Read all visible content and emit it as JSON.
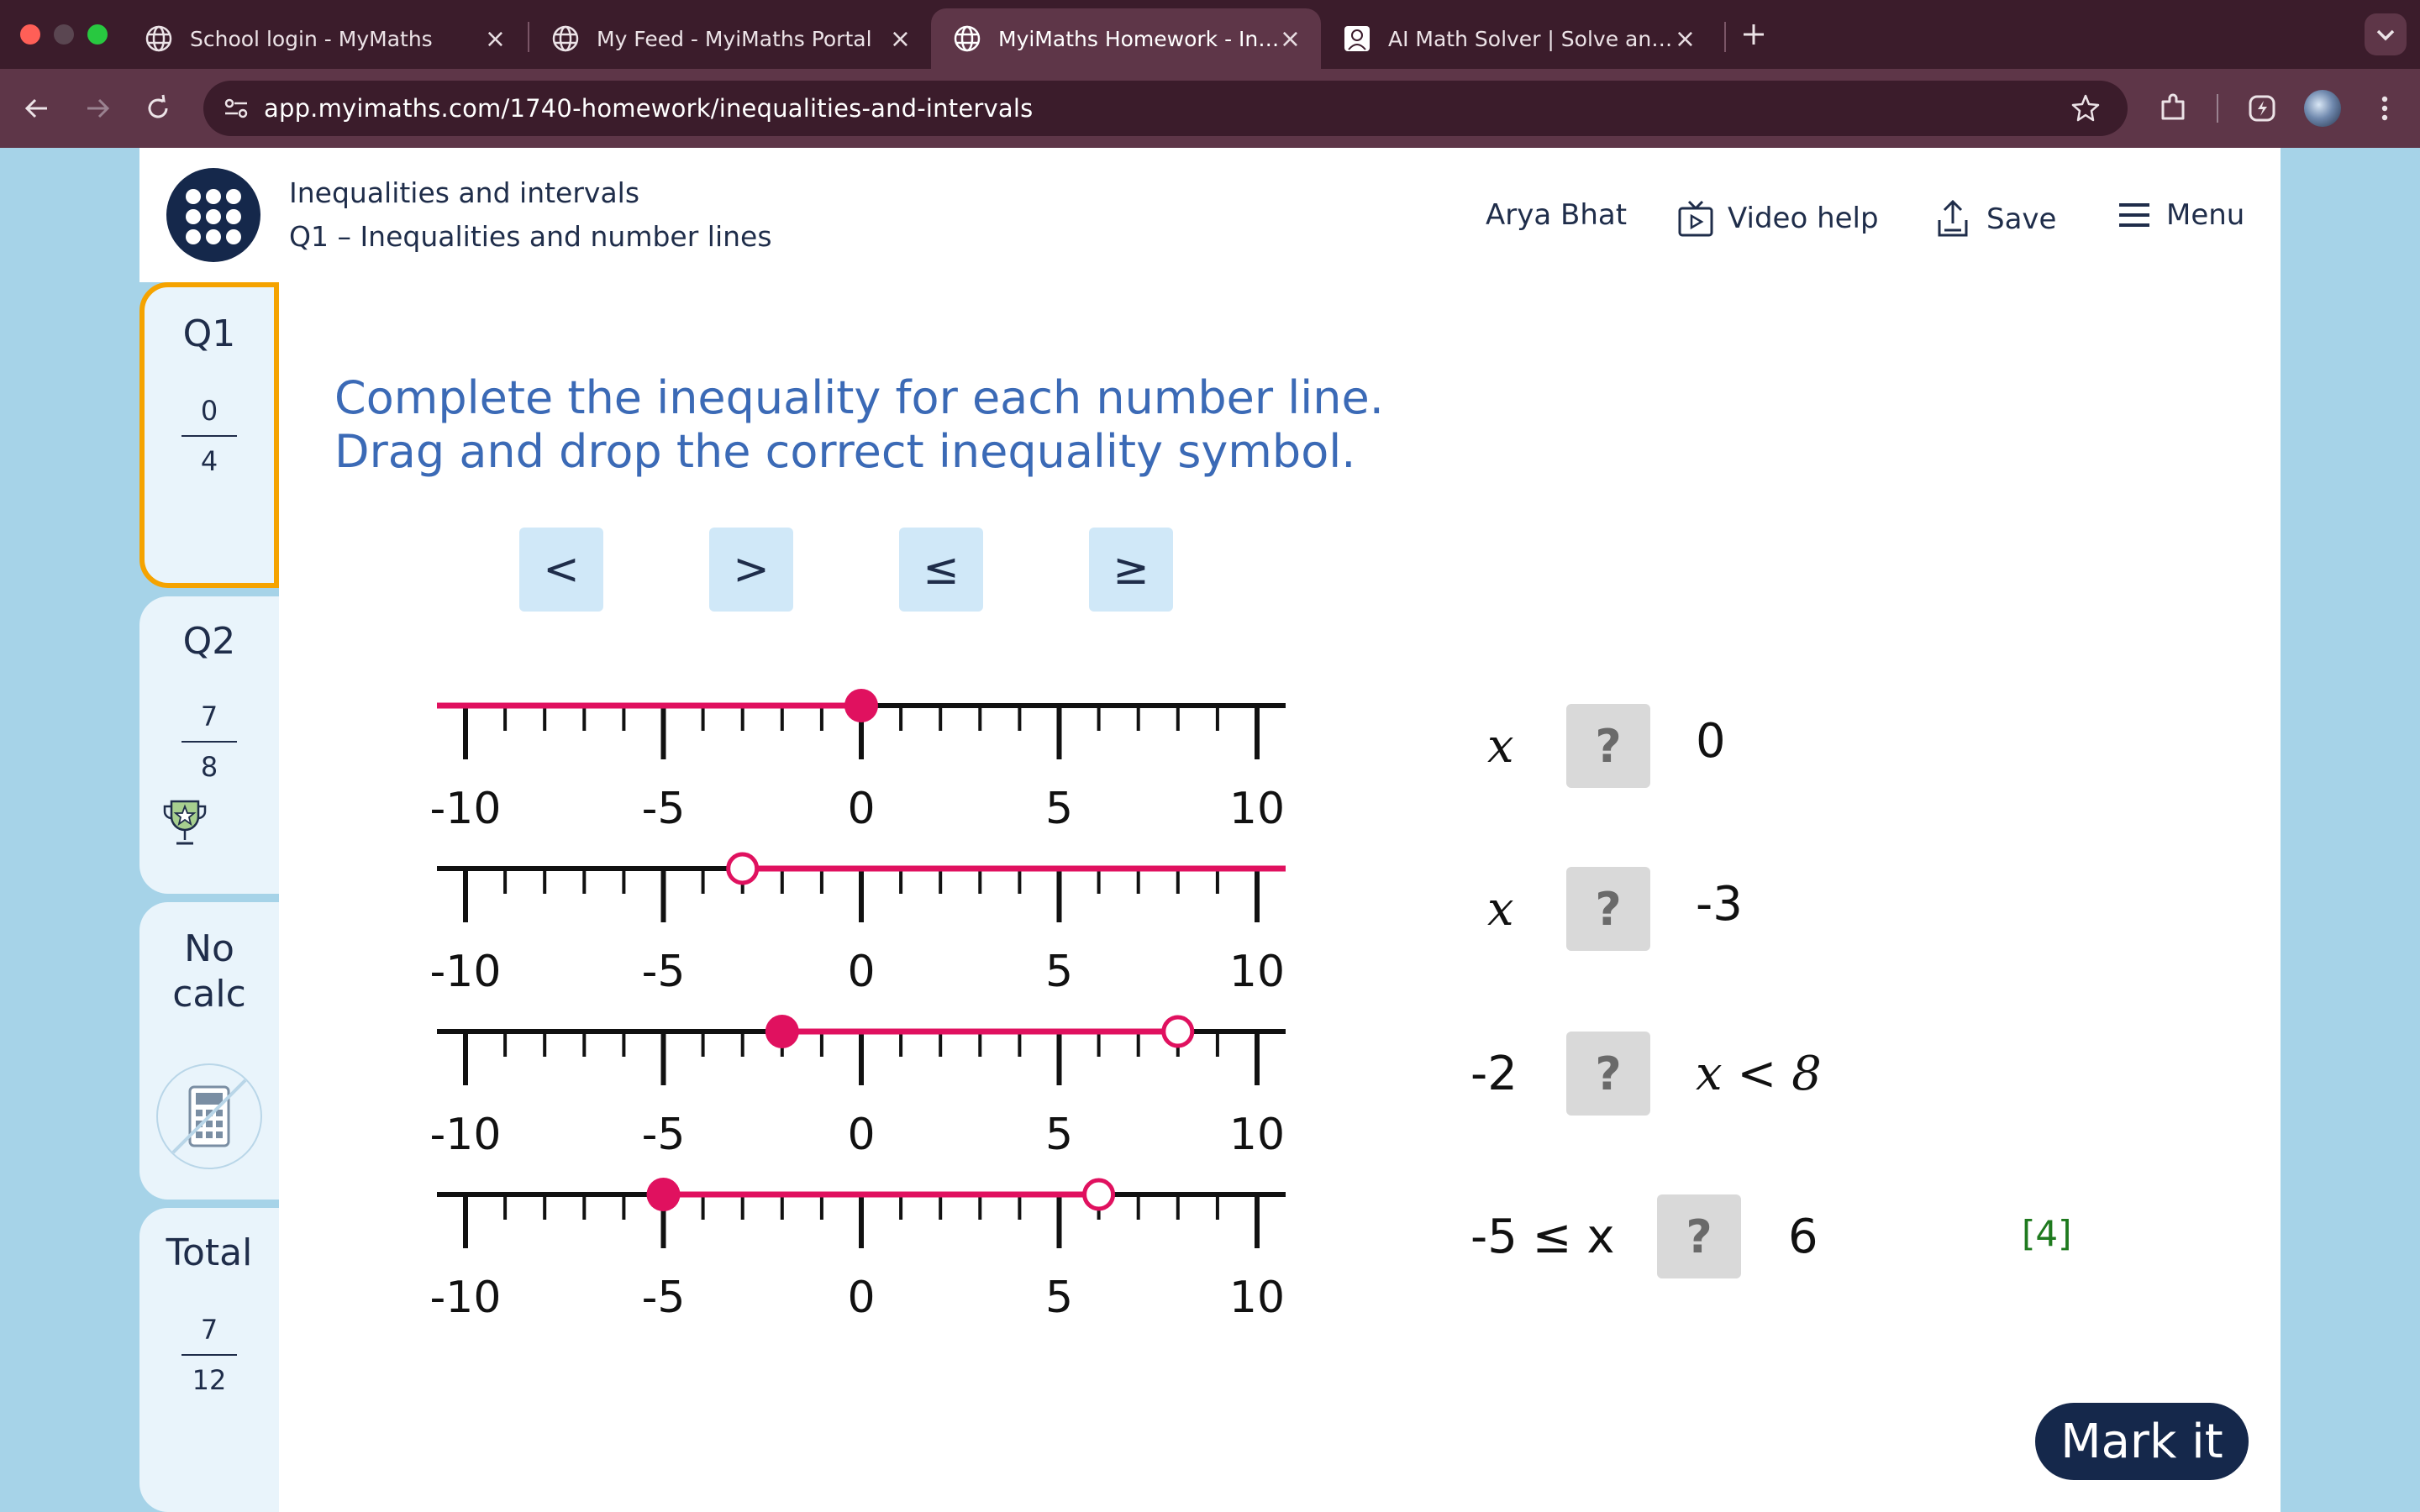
{
  "browser": {
    "tabs": [
      {
        "title": "School login - MyMaths",
        "active": false
      },
      {
        "title": "My Feed - MyiMaths Portal",
        "active": false
      },
      {
        "title": "MyiMaths Homework - Inequalities and intervals",
        "active": true
      },
      {
        "title": "AI Math Solver | Solve any problem",
        "active": false
      }
    ],
    "url": "app.myimaths.com/1740-homework/inequalities-and-intervals"
  },
  "header": {
    "topic": "Inequalities and intervals",
    "question_title": "Q1 – Inequalities and number lines",
    "user_name": "Arya Bhat",
    "video_help": "Video help",
    "save": "Save",
    "menu": "Menu"
  },
  "sidebar": {
    "q1": {
      "label": "Q1",
      "score": "0",
      "total": "4"
    },
    "q2": {
      "label": "Q2",
      "score": "7",
      "total": "8"
    },
    "calc": {
      "line1": "No",
      "line2": "calc"
    },
    "overall": {
      "label": "Total",
      "score": "7",
      "total": "12"
    }
  },
  "question": {
    "line1": "Complete the inequality for each number line.",
    "line2": "Drag and drop the correct inequality symbol.",
    "symbols": [
      "<",
      ">",
      "≤",
      "≥"
    ],
    "number_lines": [
      {
        "min": -10,
        "max": 10,
        "labels": [
          "-10",
          "-5",
          "0",
          "5",
          "10"
        ],
        "segment": [
          -10,
          0
        ],
        "points": [
          {
            "value": 0,
            "closed": true
          }
        ]
      },
      {
        "min": -10,
        "max": 10,
        "labels": [
          "-10",
          "-5",
          "0",
          "5",
          "10"
        ],
        "segment": [
          -3,
          10
        ],
        "points": [
          {
            "value": -3,
            "closed": false
          }
        ]
      },
      {
        "min": -10,
        "max": 10,
        "labels": [
          "-10",
          "-5",
          "0",
          "5",
          "10"
        ],
        "segment": [
          -2,
          8
        ],
        "points": [
          {
            "value": -2,
            "closed": true
          },
          {
            "value": 8,
            "closed": false
          }
        ]
      },
      {
        "min": -10,
        "max": 10,
        "labels": [
          "-10",
          "-5",
          "0",
          "5",
          "10"
        ],
        "segment": [
          -5,
          6
        ],
        "points": [
          {
            "value": -5,
            "closed": true
          },
          {
            "value": 6,
            "closed": false
          }
        ]
      }
    ],
    "rows": [
      {
        "left": "x",
        "blank": "?",
        "right": "0"
      },
      {
        "left": "x",
        "blank": "?",
        "right": "-3"
      },
      {
        "left": "-2",
        "blank": "?",
        "right": "x < 8"
      },
      {
        "left": "-5 ≤ x",
        "blank": "?",
        "right": "6"
      }
    ],
    "marks": "[4]",
    "mark_button": "Mark it"
  },
  "colors": {
    "accent": "#e0115f",
    "navy": "#15284b",
    "instruction": "#3b6ab6",
    "q1_border": "#f5a300",
    "marks": "#1f7a1f"
  }
}
